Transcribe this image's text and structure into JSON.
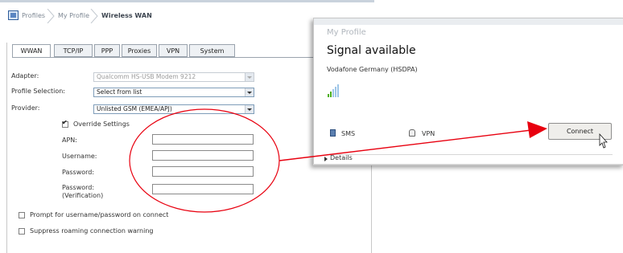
{
  "breadcrumb": {
    "items": [
      "Profiles",
      "My Profile",
      "Wireless WAN"
    ]
  },
  "tabs": [
    "WWAN",
    "TCP/IP",
    "PPP",
    "Proxies",
    "VPN",
    "System"
  ],
  "form": {
    "adapter_label": "Adapter:",
    "adapter_value": "Qualcomm HS-USB Modem 9212",
    "profile_selection_label": "Profile Selection:",
    "profile_selection_value": "Select from list",
    "provider_label": "Provider:",
    "provider_value": "Unlisted GSM (EMEA/APJ)",
    "override_label": "Override Settings",
    "override_checked": true,
    "apn_label": "APN:",
    "username_label": "Username:",
    "password_label": "Password:",
    "password_verif_label_1": "Password:",
    "password_verif_label_2": "(Verification)",
    "prompt_label": "Prompt for username/password on connect",
    "suppress_label": "Suppress roaming connection warning"
  },
  "popup": {
    "title": "My Profile",
    "status": "Signal available",
    "network": "Vodafone Germany (HSDPA)",
    "signal_bars_filled": 2,
    "signal_bars_total": 5,
    "sms_label": "SMS",
    "vpn_label": "VPN",
    "connect_label": "Connect",
    "details_label": "Details"
  },
  "colors": {
    "annotation": "#e8000f",
    "signal_on": "#4caf1e",
    "signal_off": "#9ec6e8"
  }
}
